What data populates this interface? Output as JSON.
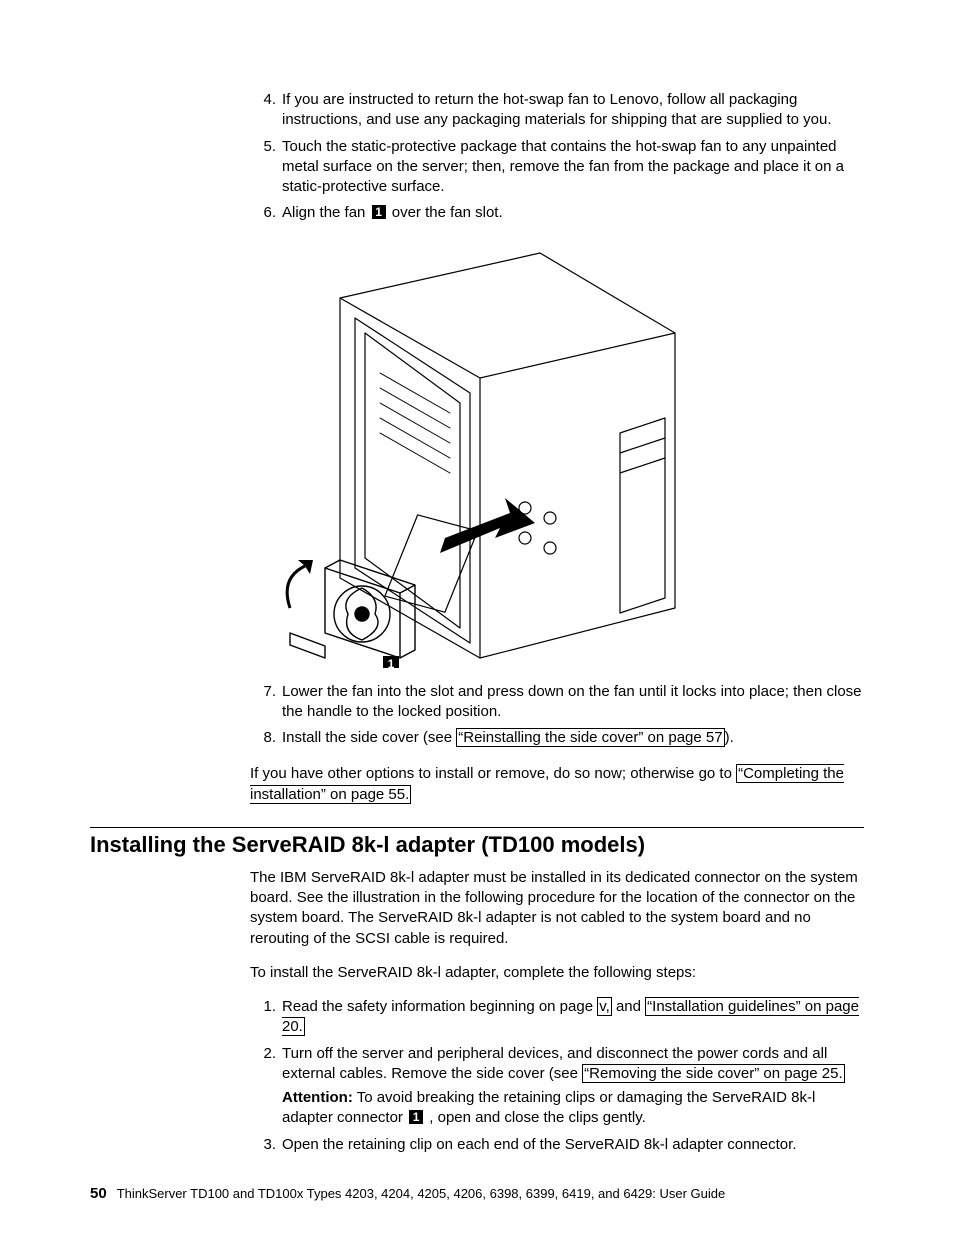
{
  "steps_top": [
    {
      "n": "4.",
      "text": "If you are instructed to return the hot-swap fan to Lenovo, follow all packaging instructions, and use any packaging materials for shipping that are supplied to you."
    },
    {
      "n": "5.",
      "text": "Touch the static-protective package that contains the hot-swap fan to any unpainted metal surface on the server; then, remove the fan from the package and place it on a static-protective surface."
    }
  ],
  "step6": {
    "n": "6.",
    "pre": "Align the fan ",
    "callout": "1",
    "post": " over the fan slot."
  },
  "diagram_callout": "1",
  "step7": {
    "n": "7.",
    "text": "Lower the fan into the slot and press down on the fan until it locks into place; then close the handle to the locked position."
  },
  "step8": {
    "n": "8.",
    "pre": "Install the side cover (see ",
    "link": "“Reinstalling the side cover” on page 57",
    "post": ")."
  },
  "post_para": {
    "pre": "If you have other options to install or remove, do so now; otherwise go to ",
    "link": "“Completing the installation” on page 55."
  },
  "section_title": "Installing the ServeRAID 8k-l adapter (TD100 models)",
  "intro1": "The IBM ServeRAID 8k-l adapter must be installed in its dedicated connector on the system board. See the illustration in the following procedure for the location of the connector on the system board. The ServeRAID 8k-l adapter is not cabled to the system board and no rerouting of the SCSI cable is required.",
  "intro2": "To install the ServeRAID 8k-l adapter, complete the following steps:",
  "steps_bottom": {
    "s1": {
      "n": "1.",
      "pre": "Read the safety information beginning on page ",
      "link1": "v,",
      "mid": " and ",
      "link2": "“Installation guidelines” on page 20."
    },
    "s2": {
      "n": "2.",
      "pre": "Turn off the server and peripheral devices, and disconnect the power cords and all external cables. Remove the side cover (see ",
      "link": "“Removing the side cover” on page 25.",
      "attn_label": "Attention:",
      "attn_pre": "  To avoid breaking the retaining clips or damaging the ServeRAID 8k-l adapter connector ",
      "callout": "1",
      "attn_post": " , open and close the clips gently."
    },
    "s3": {
      "n": "3.",
      "text": "Open the retaining clip on each end of the ServeRAID 8k-l adapter connector."
    }
  },
  "footer": {
    "page": "50",
    "text": "ThinkServer TD100 and TD100x Types 4203, 4204, 4205, 4206, 6398, 6399, 6419, and 6429: User Guide"
  }
}
